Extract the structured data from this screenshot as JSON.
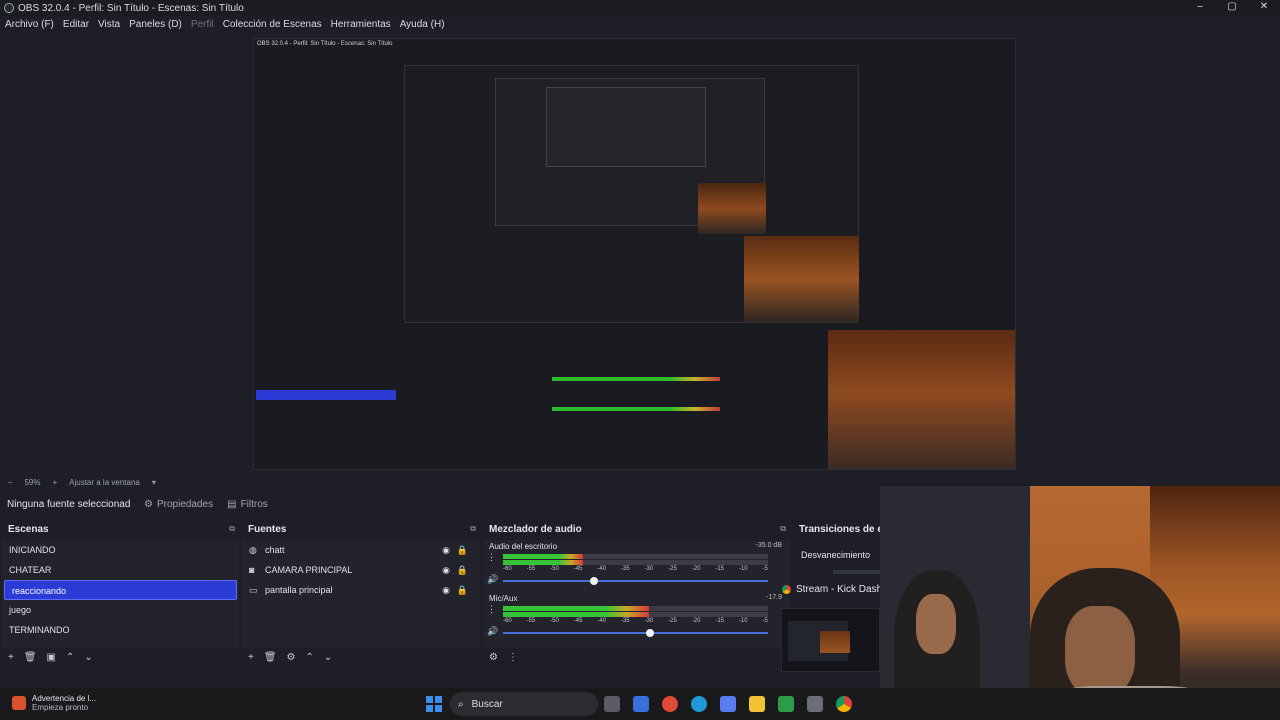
{
  "window": {
    "title": "OBS 32.0.4 - Perfil: Sin Título - Escenas: Sin Título",
    "min": "–",
    "max": "▢",
    "close": "✕"
  },
  "menu": {
    "archivo": "Archivo (F)",
    "editar": "Editar",
    "vista": "Vista",
    "paneles": "Paneles (D)",
    "perfil": "Perfil",
    "coleccion": "Colección de Escenas",
    "herramientas": "Herramientas",
    "ayuda": "Ayuda (H)"
  },
  "status": {
    "zoom": "59%",
    "fit": "Ajustar a la ventana"
  },
  "source_bar": {
    "none_selected": "Ninguna fuente seleccionad",
    "properties": "Propiedades",
    "filters": "Filtros"
  },
  "scenes": {
    "title": "Escenas",
    "items": [
      "INICIANDO",
      "CHATEAR",
      "reaccionando",
      "juego",
      "TERMINANDO"
    ],
    "selected": "reaccionando"
  },
  "sources": {
    "title": "Fuentes",
    "items": [
      {
        "label": "chatt",
        "icon": "globe-icon"
      },
      {
        "label": "CAMARA PRINCIPAL",
        "icon": "camera-icon"
      },
      {
        "label": "pantalla principal",
        "icon": "monitor-icon"
      }
    ]
  },
  "mixer": {
    "title": "Mezclador de audio",
    "channels": [
      {
        "name": "Audio del escritorio",
        "db": "-35.0 dB",
        "level": 0.3,
        "volume": 0.33
      },
      {
        "name": "Mic/Aux",
        "db": "-17.9",
        "level": 0.55,
        "volume": 0.54
      }
    ],
    "ticks": [
      "-60",
      "-55",
      "-50",
      "-45",
      "-40",
      "-35",
      "-30",
      "-25",
      "-20",
      "-15",
      "-10",
      "-5"
    ]
  },
  "transitions": {
    "title": "Transiciones de esc",
    "selected": "Desvanecimiento"
  },
  "overlay": {
    "chrome_item": "Stream - Kick Dashb"
  },
  "taskbar": {
    "notification_title": "Advertencia de l...",
    "notification_sub": "Empieza pronto",
    "search": "Buscar"
  },
  "colors": {
    "accent": "#2a3bd6",
    "meter_green": "#36c436",
    "meter_yellow": "#caa72a",
    "meter_red": "#d23838"
  }
}
